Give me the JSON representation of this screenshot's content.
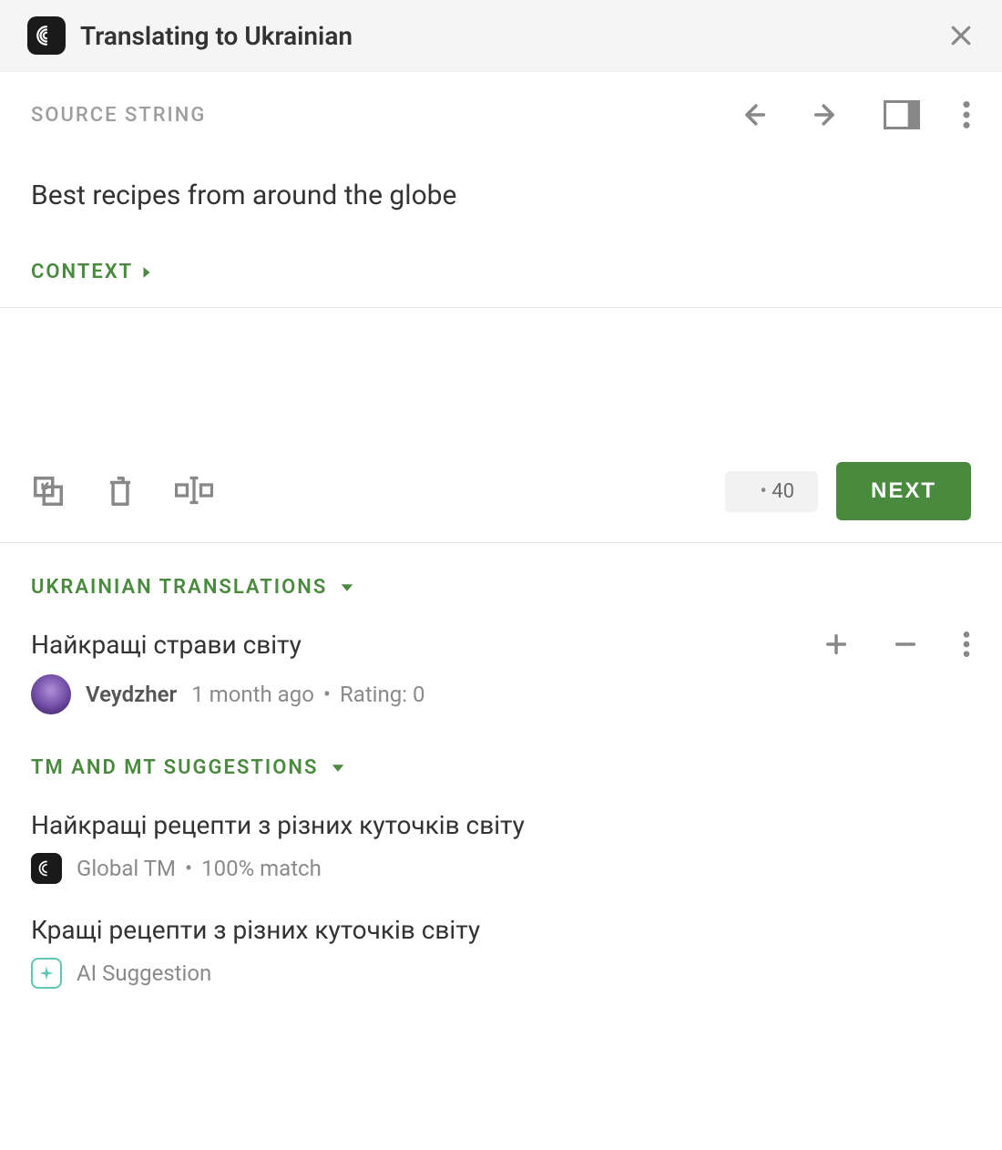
{
  "header": {
    "title": "Translating to Ukrainian"
  },
  "source": {
    "section_label": "SOURCE STRING",
    "text": "Best recipes from around the globe",
    "context_label": "CONTEXT"
  },
  "editor": {
    "char_count": "40",
    "next_label": "NEXT"
  },
  "translations": {
    "section_label": "UKRAINIAN TRANSLATIONS",
    "items": [
      {
        "text": "Найкращі страви світу",
        "author": "Veydzher",
        "age": "1 month ago",
        "rating_label": "Rating: 0"
      }
    ]
  },
  "suggestions": {
    "section_label": "TM AND MT SUGGESTIONS",
    "items": [
      {
        "text": "Найкращі рецепти з різних куточків світу",
        "source": "Global TM",
        "match": "100% match",
        "icon": "tm"
      },
      {
        "text": "Кращі рецепти з різних куточків світу",
        "source": "AI Suggestion",
        "match": "",
        "icon": "ai"
      }
    ]
  }
}
